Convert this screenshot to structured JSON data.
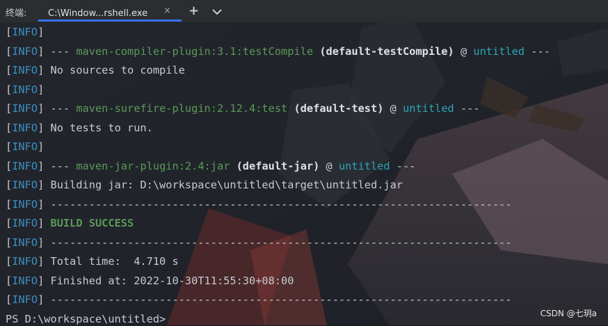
{
  "tabbar": {
    "panel_title": "终端:",
    "tab_label": "C:\\Window...rshell.exe",
    "close_glyph": "×",
    "add_glyph": "+"
  },
  "console": {
    "lines": [
      {
        "type": "info",
        "text": ""
      },
      {
        "type": "plugin",
        "plugin": "maven-compiler-plugin:3.1:testCompile",
        "goal": "(default-testCompile)",
        "project": "untitled"
      },
      {
        "type": "info",
        "text": "No sources to compile"
      },
      {
        "type": "info",
        "text": ""
      },
      {
        "type": "plugin",
        "plugin": "maven-surefire-plugin:2.12.4:test",
        "goal": "(default-test)",
        "project": "untitled"
      },
      {
        "type": "info",
        "text": "No tests to run."
      },
      {
        "type": "info",
        "text": ""
      },
      {
        "type": "plugin",
        "plugin": "maven-jar-plugin:2.4:jar",
        "goal": "(default-jar)",
        "project": "untitled"
      },
      {
        "type": "info",
        "text": "Building jar: D:\\workspace\\untitled\\target\\untitled.jar"
      },
      {
        "type": "info",
        "text": "------------------------------------------------------------------------"
      },
      {
        "type": "success",
        "text": "BUILD SUCCESS"
      },
      {
        "type": "info",
        "text": "------------------------------------------------------------------------"
      },
      {
        "type": "info",
        "text": "Total time:  4.710 s"
      },
      {
        "type": "info",
        "text": "Finished at: 2022-10-30T11:55:30+08:00"
      },
      {
        "type": "info",
        "text": "------------------------------------------------------------------------"
      },
      {
        "type": "prompt",
        "text": "PS D:\\workspace\\untitled>"
      }
    ],
    "info_tag": "INFO",
    "sep": "---"
  },
  "watermark": "CSDN @七玥a",
  "colors": {
    "info": "#3a8fc3",
    "plugin": "#5a9a58",
    "project": "#2ba6b8",
    "tab_underline": "#3574f0"
  }
}
